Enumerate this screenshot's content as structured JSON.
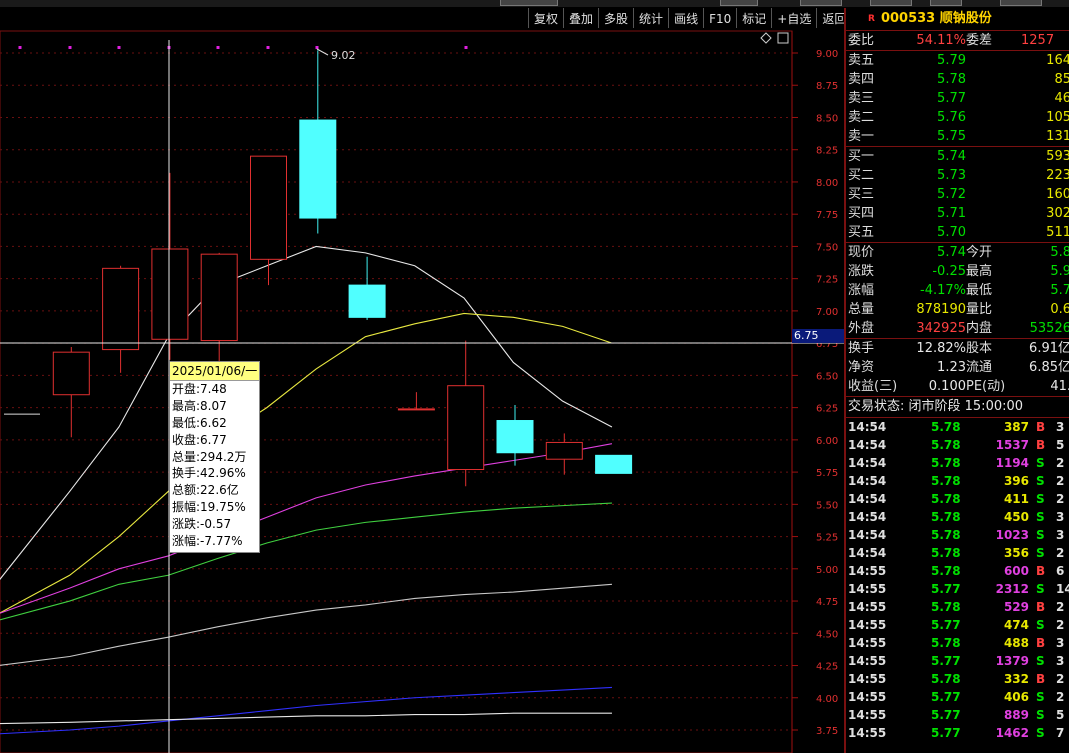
{
  "toolbar": [
    "复权",
    "叠加",
    "多股",
    "统计",
    "画线",
    "F10",
    "标记",
    "+自选",
    "返回"
  ],
  "stock": {
    "marker": "R",
    "code": "000533",
    "name": "顺钠股份"
  },
  "quote": {
    "weibi_label": "委比",
    "weibi": "54.11%",
    "weicha_label": "委差",
    "weicha": "1257",
    "asks": [
      {
        "label": "卖五",
        "price": "5.79",
        "vol": "164"
      },
      {
        "label": "卖四",
        "price": "5.78",
        "vol": "85"
      },
      {
        "label": "卖三",
        "price": "5.77",
        "vol": "46"
      },
      {
        "label": "卖二",
        "price": "5.76",
        "vol": "105"
      },
      {
        "label": "卖一",
        "price": "5.75",
        "vol": "131"
      }
    ],
    "bids": [
      {
        "label": "买一",
        "price": "5.74",
        "vol": "593"
      },
      {
        "label": "买二",
        "price": "5.73",
        "vol": "223"
      },
      {
        "label": "买三",
        "price": "5.72",
        "vol": "160"
      },
      {
        "label": "买四",
        "price": "5.71",
        "vol": "302"
      },
      {
        "label": "买五",
        "price": "5.70",
        "vol": "511"
      }
    ],
    "stats1": [
      {
        "l1": "现价",
        "v1": "5.74",
        "c1": "green",
        "l2": "今开",
        "v2": "5.8",
        "c2": "green"
      },
      {
        "l1": "涨跌",
        "v1": "-0.25",
        "c1": "green",
        "l2": "最高",
        "v2": "5.9",
        "c2": "green"
      },
      {
        "l1": "涨幅",
        "v1": "-4.17%",
        "c1": "green",
        "l2": "最低",
        "v2": "5.7",
        "c2": "green"
      },
      {
        "l1": "总量",
        "v1": "878190",
        "c1": "yellow",
        "l2": "量比",
        "v2": "0.6",
        "c2": "yellow"
      },
      {
        "l1": "外盘",
        "v1": "342925",
        "c1": "red",
        "l2": "内盘",
        "v2": "53526",
        "c2": "green"
      }
    ],
    "stats2": [
      {
        "l1": "换手",
        "v1": "12.82%",
        "l2": "股本",
        "v2": "6.91亿"
      },
      {
        "l1": "净资",
        "v1": "1.23",
        "l2": "流通",
        "v2": "6.85亿"
      },
      {
        "l1": "收益(三)",
        "v1": "0.100",
        "l2": "PE(动)",
        "v2": "41."
      }
    ],
    "status": "交易状态: 闭市阶段 15:00:00"
  },
  "ticks": [
    {
      "t": "14:54",
      "p": "5.78",
      "v": "387",
      "vc": "yellow",
      "bs": "B",
      "n": "3"
    },
    {
      "t": "14:54",
      "p": "5.78",
      "v": "1537",
      "vc": "magenta",
      "bs": "B",
      "n": "5"
    },
    {
      "t": "14:54",
      "p": "5.78",
      "v": "1194",
      "vc": "magenta",
      "bs": "S",
      "n": "2"
    },
    {
      "t": "14:54",
      "p": "5.78",
      "v": "396",
      "vc": "yellow",
      "bs": "S",
      "n": "2"
    },
    {
      "t": "14:54",
      "p": "5.78",
      "v": "411",
      "vc": "yellow",
      "bs": "S",
      "n": "2"
    },
    {
      "t": "14:54",
      "p": "5.78",
      "v": "450",
      "vc": "yellow",
      "bs": "S",
      "n": "3"
    },
    {
      "t": "14:54",
      "p": "5.78",
      "v": "1023",
      "vc": "magenta",
      "bs": "S",
      "n": "3"
    },
    {
      "t": "14:54",
      "p": "5.78",
      "v": "356",
      "vc": "yellow",
      "bs": "S",
      "n": "2"
    },
    {
      "t": "14:55",
      "p": "5.78",
      "v": "600",
      "vc": "magenta",
      "bs": "B",
      "n": "6"
    },
    {
      "t": "14:55",
      "p": "5.77",
      "v": "2312",
      "vc": "magenta",
      "bs": "S",
      "n": "14"
    },
    {
      "t": "14:55",
      "p": "5.78",
      "v": "529",
      "vc": "magenta",
      "bs": "B",
      "n": "2"
    },
    {
      "t": "14:55",
      "p": "5.77",
      "v": "474",
      "vc": "yellow",
      "bs": "S",
      "n": "2"
    },
    {
      "t": "14:55",
      "p": "5.78",
      "v": "488",
      "vc": "yellow",
      "bs": "B",
      "n": "3"
    },
    {
      "t": "14:55",
      "p": "5.77",
      "v": "1379",
      "vc": "magenta",
      "bs": "S",
      "n": "3"
    },
    {
      "t": "14:55",
      "p": "5.78",
      "v": "332",
      "vc": "yellow",
      "bs": "B",
      "n": "2"
    },
    {
      "t": "14:55",
      "p": "5.77",
      "v": "406",
      "vc": "yellow",
      "bs": "S",
      "n": "2"
    },
    {
      "t": "14:55",
      "p": "5.77",
      "v": "889",
      "vc": "magenta",
      "bs": "S",
      "n": "5"
    },
    {
      "t": "14:55",
      "p": "5.77",
      "v": "1462",
      "vc": "magenta",
      "bs": "S",
      "n": "7"
    }
  ],
  "tooltip": {
    "date": "2025/01/06/一",
    "lines": [
      "开盘:7.48",
      "最高:8.07",
      "最低:6.62",
      "收盘:6.77",
      "总量:294.2万",
      "换手:42.96%",
      "总额:22.6亿",
      "振幅:19.75%",
      "涨跌:-0.57",
      "涨幅:-7.77%"
    ]
  },
  "crosshair_price": "6.75",
  "chart_data": {
    "type": "candlestick",
    "y_ticks": [
      "9.00",
      "8.75",
      "8.50",
      "8.25",
      "8.00",
      "7.75",
      "7.50",
      "7.25",
      "7.00",
      "6.75",
      "6.50",
      "6.25",
      "6.00",
      "5.75",
      "5.50",
      "5.25",
      "5.00",
      "4.75",
      "4.50",
      "4.25",
      "4.00",
      "3.75"
    ],
    "ylim": [
      3.7,
      9.1
    ],
    "high_label": "9.02",
    "candles": [
      {
        "o": 6.2,
        "h": 6.2,
        "l": 6.2,
        "c": 6.2
      },
      {
        "o": 6.35,
        "h": 6.72,
        "l": 6.02,
        "c": 6.68
      },
      {
        "o": 6.7,
        "h": 7.35,
        "l": 6.52,
        "c": 7.33
      },
      {
        "o": 6.78,
        "h": 8.07,
        "l": 6.62,
        "c": 7.48
      },
      {
        "o": 6.77,
        "h": 7.45,
        "l": 6.55,
        "c": 7.44
      },
      {
        "o": 7.4,
        "h": 8.2,
        "l": 7.2,
        "c": 8.2
      },
      {
        "o": 8.48,
        "h": 9.02,
        "l": 7.6,
        "c": 7.72
      },
      {
        "o": 7.2,
        "h": 7.42,
        "l": 6.93,
        "c": 6.95
      },
      {
        "o": 6.24,
        "h": 6.37,
        "l": 6.24,
        "c": 6.24
      },
      {
        "o": 5.77,
        "h": 6.77,
        "l": 5.64,
        "c": 6.42
      },
      {
        "o": 6.15,
        "h": 6.27,
        "l": 5.8,
        "c": 5.9
      },
      {
        "o": 5.85,
        "h": 6.05,
        "l": 5.73,
        "c": 5.98
      },
      {
        "o": 5.88,
        "h": 5.88,
        "l": 5.74,
        "c": 5.74
      }
    ],
    "ma_lines": [
      {
        "color": "#e8e8e8",
        "values": [
          4.9,
          5.6,
          6.1,
          6.8,
          7.2,
          7.35,
          7.5,
          7.45,
          7.35,
          7.1,
          6.6,
          6.3,
          6.1
        ]
      },
      {
        "color": "#e8e840",
        "values": [
          4.65,
          4.95,
          5.25,
          5.6,
          6.0,
          6.25,
          6.55,
          6.8,
          6.9,
          6.98,
          6.95,
          6.88,
          6.75
        ]
      },
      {
        "color": "#e040e0",
        "values": [
          4.65,
          4.85,
          5.0,
          5.1,
          5.25,
          5.4,
          5.55,
          5.65,
          5.72,
          5.78,
          5.84,
          5.9,
          5.97
        ]
      },
      {
        "color": "#40d040",
        "values": [
          4.6,
          4.75,
          4.88,
          4.95,
          5.08,
          5.2,
          5.3,
          5.36,
          5.4,
          5.44,
          5.47,
          5.49,
          5.51
        ]
      },
      {
        "color": "#c8c8c8",
        "values": [
          4.25,
          4.32,
          4.4,
          4.47,
          4.55,
          4.62,
          4.68,
          4.72,
          4.77,
          4.8,
          4.82,
          4.85,
          4.88
        ]
      },
      {
        "color": "#3030ff",
        "values": [
          3.72,
          3.75,
          3.78,
          3.82,
          3.86,
          3.9,
          3.94,
          3.97,
          4.0,
          4.02,
          4.04,
          4.06,
          4.08
        ]
      },
      {
        "color": "#e8e8e8",
        "values": [
          3.8,
          3.81,
          3.82,
          3.83,
          3.84,
          3.85,
          3.86,
          3.86,
          3.87,
          3.87,
          3.88,
          3.88,
          3.88
        ]
      }
    ]
  }
}
